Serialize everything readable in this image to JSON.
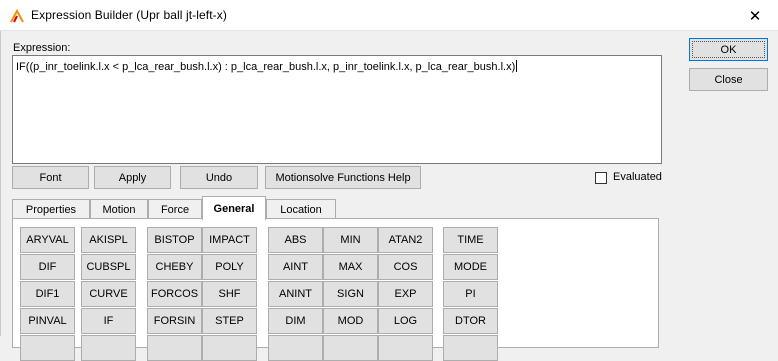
{
  "window": {
    "title": "Expression Builder (Upr ball jt-left-x)",
    "close_glyph": "✕"
  },
  "expression": {
    "label": "Expression:",
    "value": "IF((p_inr_toelink.l.x < p_lca_rear_bush.l.x) : p_lca_rear_bush.l.x, p_inr_toelink.l.x, p_lca_rear_bush.l.x)"
  },
  "buttons": {
    "ok": "OK",
    "close": "Close",
    "font": "Font",
    "apply": "Apply",
    "undo": "Undo",
    "help": "Motionsolve Functions Help"
  },
  "evaluated": {
    "label": "Evaluated",
    "checked": false
  },
  "tabs": [
    "Properties",
    "Motion",
    "Force",
    "General",
    "Location"
  ],
  "active_tab": "General",
  "functions": {
    "col1": [
      "ARYVAL",
      "DIF",
      "DIF1",
      "PINVAL",
      ""
    ],
    "col2": [
      "AKISPL",
      "CUBSPL",
      "CURVE",
      "IF",
      ""
    ],
    "col3": [
      "BISTOP",
      "CHEBY",
      "FORCOS",
      "FORSIN",
      ""
    ],
    "col4": [
      "IMPACT",
      "POLY",
      "SHF",
      "STEP",
      ""
    ],
    "col5": [
      "ABS",
      "AINT",
      "ANINT",
      "DIM",
      ""
    ],
    "col6": [
      "MIN",
      "MAX",
      "SIGN",
      "MOD",
      ""
    ],
    "col7": [
      "ATAN2",
      "COS",
      "EXP",
      "LOG",
      ""
    ],
    "col8": [
      "TIME",
      "MODE",
      "PI",
      "DTOR",
      ""
    ]
  },
  "colors": {
    "accent": "#0078d7",
    "button_face": "#e1e1e1",
    "button_border": "#adadad"
  }
}
